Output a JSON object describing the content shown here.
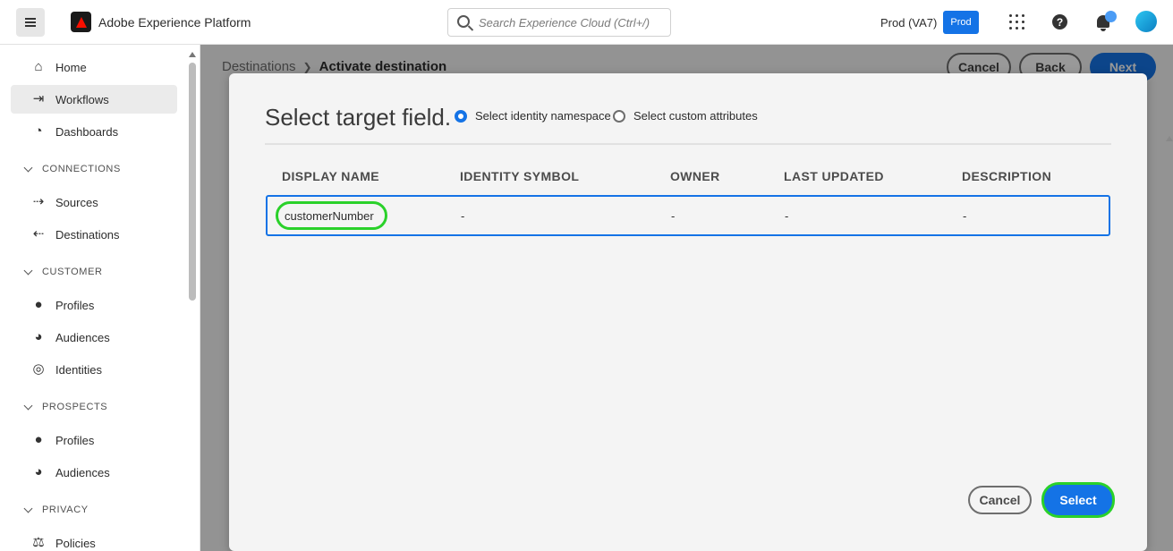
{
  "header": {
    "app_title": "Adobe Experience Platform",
    "search_placeholder": "Search Experience Cloud (Ctrl+/)",
    "org_name": "Prod (VA7)",
    "sandbox_badge": "Prod"
  },
  "sidebar": {
    "items": [
      {
        "label": "Home",
        "icon": "home-icon"
      },
      {
        "label": "Workflows",
        "icon": "workflows-icon",
        "active": true
      },
      {
        "label": "Dashboards",
        "icon": "dashboard-icon"
      }
    ],
    "sections": [
      {
        "title": "CONNECTIONS",
        "items": [
          {
            "label": "Sources",
            "icon": "sources-icon"
          },
          {
            "label": "Destinations",
            "icon": "destinations-icon"
          }
        ]
      },
      {
        "title": "CUSTOMER",
        "items": [
          {
            "label": "Profiles",
            "icon": "profile-icon"
          },
          {
            "label": "Audiences",
            "icon": "audiences-icon"
          },
          {
            "label": "Identities",
            "icon": "fingerprint-icon"
          }
        ]
      },
      {
        "title": "PROSPECTS",
        "items": [
          {
            "label": "Profiles",
            "icon": "profile-icon"
          },
          {
            "label": "Audiences",
            "icon": "audiences-icon"
          }
        ]
      },
      {
        "title": "PRIVACY",
        "items": [
          {
            "label": "Policies",
            "icon": "policies-icon"
          }
        ]
      }
    ]
  },
  "page": {
    "breadcrumb_root": "Destinations",
    "breadcrumb_current": "Activate destination",
    "cancel_label": "Cancel",
    "back_label": "Back",
    "next_label": "Next"
  },
  "dialog": {
    "title": "Select target field.",
    "radio_identity": "Select identity namespace",
    "radio_custom": "Select custom attributes",
    "selected_radio": "identity",
    "columns": [
      "DISPLAY NAME",
      "IDENTITY SYMBOL",
      "OWNER",
      "LAST UPDATED",
      "DESCRIPTION"
    ],
    "rows": [
      {
        "display_name": "customerNumber",
        "identity_symbol": "-",
        "owner": "-",
        "last_updated": "-",
        "description": "-"
      }
    ],
    "cancel_label": "Cancel",
    "select_label": "Select"
  },
  "colors": {
    "accent": "#1473e6",
    "highlight": "#2ad12a",
    "brand_red": "#fa0f00"
  }
}
